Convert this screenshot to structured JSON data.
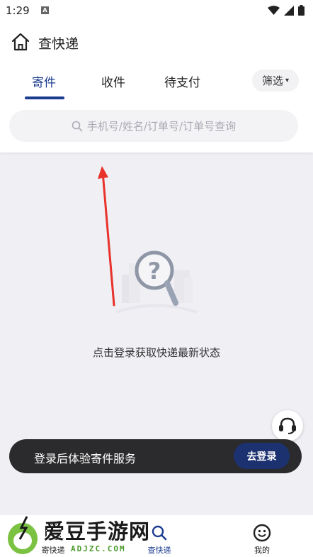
{
  "status_bar": {
    "time": "1:29",
    "notification_badge": "A"
  },
  "header": {
    "title": "查快递",
    "home_icon": "home-icon"
  },
  "tabs": [
    {
      "label": "寄件",
      "active": true
    },
    {
      "label": "收件",
      "active": false
    },
    {
      "label": "待支付",
      "active": false
    }
  ],
  "filter": {
    "label": "筛选",
    "caret": "▾"
  },
  "search": {
    "placeholder": "手机号/姓名/订单号/订单号查询"
  },
  "empty_state": {
    "message": "点击登录获取快递最新状态"
  },
  "login_bar": {
    "text": "登录后体验寄件服务",
    "button_label": "去登录"
  },
  "bottom_nav": [
    {
      "label": "寄快递",
      "icon": "send-express-icon",
      "active": false
    },
    {
      "label": "查快递",
      "icon": "search-express-icon",
      "active": true
    },
    {
      "label": "我的",
      "icon": "smiley-icon",
      "active": false
    }
  ],
  "watermark": {
    "title": "爱豆手游网",
    "subtitle": "ADJZC.COM"
  },
  "colors": {
    "accent": "#1c3c90",
    "login_bar": "#2b2b2d",
    "login_button": "#1c3170",
    "background": "#efeff4",
    "arrow": "#e8322b"
  }
}
